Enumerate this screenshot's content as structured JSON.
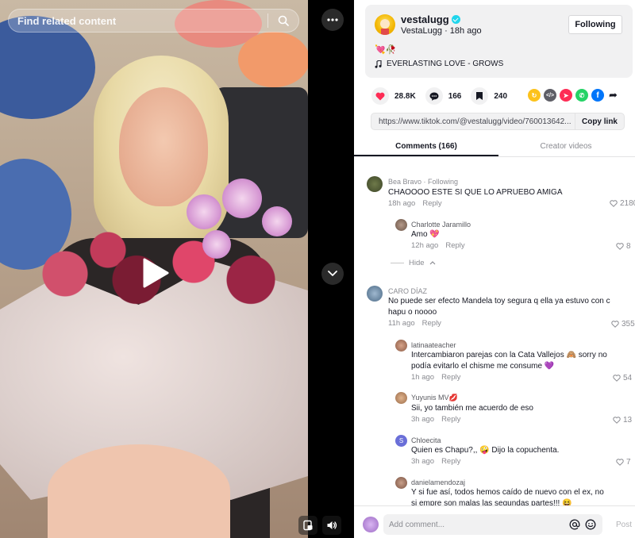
{
  "search": {
    "placeholder": "Find related content"
  },
  "author": {
    "handle": "vestalugg",
    "display": "VestaLugg",
    "time": "18h ago",
    "follow_label": "Following",
    "emoji": "💘🥀",
    "music": "EVERLASTING LOVE - GROWS"
  },
  "stats": {
    "likes": "28.8K",
    "comments": "166",
    "saves": "240"
  },
  "link": {
    "url": "https://www.tiktok.com/@vestalugg/video/760013642...",
    "copy_label": "Copy link"
  },
  "tabs": {
    "comments": "Comments (166)",
    "creator": "Creator videos"
  },
  "comments": [
    {
      "user": "Bea Bravo · Following",
      "text": "CHAOOOO ESTE SI QUE LO APRUEBO AMIGA",
      "time": "18h ago",
      "reply": "Reply",
      "likes": "2180"
    },
    {
      "user": "Charlotte Jaramillo",
      "text": "Amo 💖",
      "time": "12h ago",
      "reply": "Reply",
      "likes": "8"
    },
    {
      "user": "CARO DÍAZ",
      "text": "No puede ser efecto Mandela toy segura q ella ya estuvo con c hapu o noooo",
      "time": "11h ago",
      "reply": "Reply",
      "likes": "355"
    },
    {
      "user": "latinaateacher",
      "text": "Intercambiaron parejas con la Cata Vallejos 🙈 sorry no podía evitarlo el chisme me consume 💜",
      "time": "1h ago",
      "reply": "Reply",
      "likes": "54"
    },
    {
      "user": "Yuyunis MV💋",
      "text": "Sii, yo también me acuerdo de eso",
      "time": "3h ago",
      "reply": "Reply",
      "likes": "13"
    },
    {
      "user": "Chloecita",
      "text": "Quien es Chapu?,, 🤪 Dijo la copuchenta.",
      "time": "3h ago",
      "reply": "Reply",
      "likes": "7"
    },
    {
      "user": "danielamendozaj",
      "text": "Y si fue así, todos hemos caído de nuevo con el ex, no si empre son malas las segundas partes!!! 😆",
      "time": "",
      "reply": "",
      "likes": ""
    }
  ],
  "hide_label": "Hide",
  "comment_input": {
    "placeholder": "Add comment...",
    "post_label": "Post"
  },
  "colors": {
    "accent": "#fe2c55",
    "verified": "#20d5ec",
    "text": "#161823"
  }
}
